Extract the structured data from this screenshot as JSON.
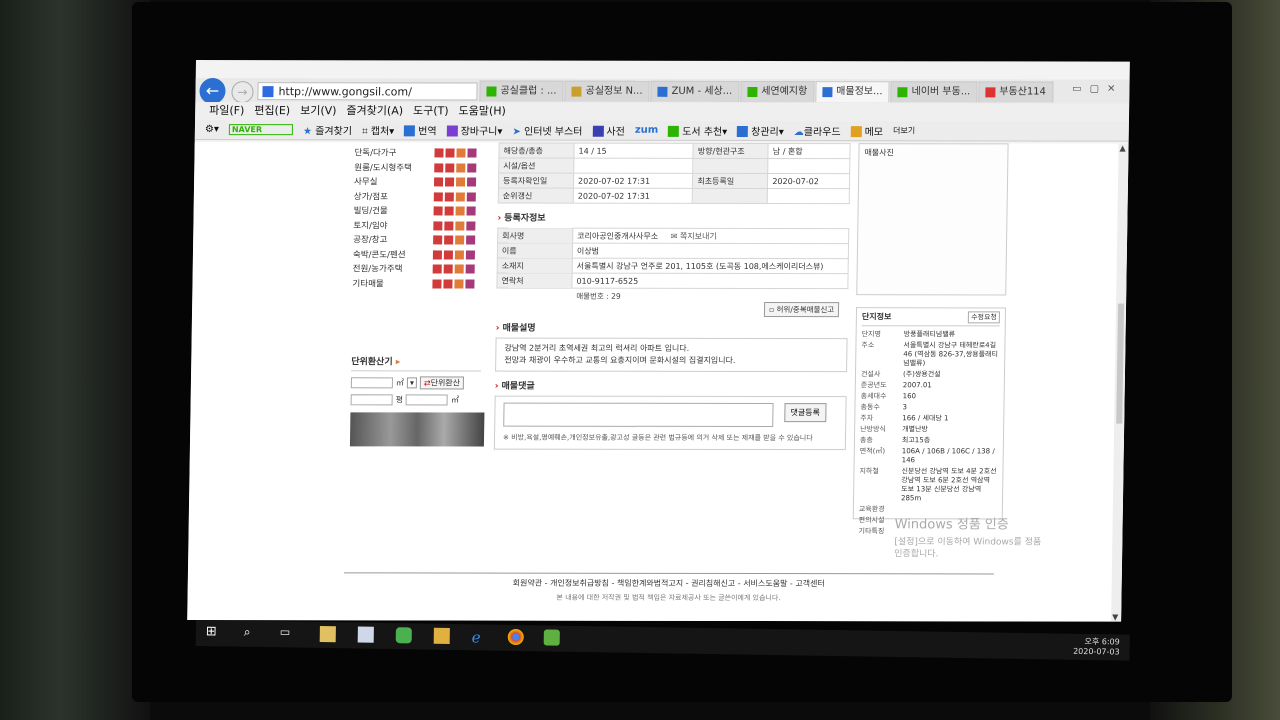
{
  "browser": {
    "address": "http://www.gongsil.com/",
    "tabs": [
      {
        "label": "공실클럽 : ...",
        "color": "#2db400",
        "active": false
      },
      {
        "label": "공실정보 N...",
        "color": "#c9a030",
        "active": false
      },
      {
        "label": "ZUM - 세상...",
        "color": "#2a6fd1",
        "active": false
      },
      {
        "label": "세연예지항",
        "color": "#2db400",
        "active": false
      },
      {
        "label": "매물정보...",
        "color": "#2a6fd1",
        "active": true
      },
      {
        "label": "네이버 부동...",
        "color": "#2db400",
        "active": false
      },
      {
        "label": "부동산114",
        "color": "#d33",
        "active": false
      }
    ],
    "menu": [
      "파일(F)",
      "편집(E)",
      "보기(V)",
      "즐겨찾기(A)",
      "도구(T)",
      "도움말(H)"
    ],
    "toolbar": {
      "naver": "NAVER",
      "favorites": "즐겨찾기",
      "capture": "캡처",
      "translate": "번역",
      "cart": "장바구니",
      "booster": "인터넷 부스터",
      "dict": "사전",
      "zum": "zum",
      "book": "도서 추천",
      "manage": "창관리",
      "cloud": "클라우드",
      "memo": "메모",
      "more": "더보기"
    }
  },
  "left_menu": {
    "items": [
      "단독/다가구",
      "원룸/도시형주택",
      "사무실",
      "상가/점포",
      "빌딩/건물",
      "토지/임야",
      "공장/창고",
      "숙박/콘도/펜션",
      "전원/농가주택",
      "기타매물"
    ],
    "box_colors": [
      "#d23b3b",
      "#d23b3b",
      "#e07b39",
      "#a5397a"
    ]
  },
  "converter": {
    "title": "단위환산기",
    "unit_m2": "㎡",
    "btn": "단위환산",
    "unit_pyeong": "평",
    "unit_m2b": "㎡"
  },
  "listing": {
    "rows": [
      [
        "해당층/총층",
        "14 / 15",
        "방향/현관구조",
        "남 / 혼합"
      ],
      [
        "시설/옵션",
        "",
        "",
        ""
      ],
      [
        "등록자확인일",
        "2020-07-02 17:31",
        "최초등록일",
        "2020-07-02"
      ],
      [
        "순위갱신",
        "2020-07-02 17:31",
        "",
        ""
      ]
    ],
    "agent_title": "등록자정보",
    "agent_rows": [
      [
        "회사명",
        "코리아공인중개사사무소",
        "쪽지보내기"
      ],
      [
        "이름",
        "이상범",
        ""
      ],
      [
        "소재지",
        "서울특별시 강남구 언주로 201, 1105호 (도곡동 108,에스케이리더스뷰)",
        ""
      ],
      [
        "연락처",
        "010-9117-6525",
        ""
      ]
    ],
    "memo_no": "매물번호 : 29",
    "report_btn": "허위/중복매물신고",
    "desc_title": "매물설명",
    "desc_lines": [
      "강남역 2분거리 초역세권 최고의 럭셔리 아파트 입니다.",
      "전망과 채광이 우수하고 교통의 요충지이며 문화시설의 집결지입니다."
    ],
    "comment_title": "매물댓글",
    "comment_btn": "댓글등록",
    "comment_note": "※ 비방,욕설,명예훼손,개인정보유출,광고성 글등은 관련 법규등에 의거 삭제 또는 제재를 받을 수 있습니다"
  },
  "right": {
    "photo_title": "매물사진",
    "complex_title": "단지정보",
    "complex_btn": "수정요청",
    "rows": [
      [
        "단지명",
        "방풍플래티넘밸류"
      ],
      [
        "주소",
        "서울특별시 강남구 테헤란로4길 46 (역삼동 826-37,쌍용플래티넘밸류)"
      ],
      [
        "건설사",
        "(주)쌍용건설"
      ],
      [
        "준공년도",
        "2007.01"
      ],
      [
        "총세대수",
        "160"
      ],
      [
        "총동수",
        "3"
      ],
      [
        "주차",
        "166 / 세대당 1"
      ],
      [
        "난방방식",
        "개별난방"
      ],
      [
        "총층",
        "최고15층"
      ],
      [
        "면적(㎡)",
        "106A / 106B / 106C / 138 / 146"
      ],
      [
        "지하철",
        "신분당선 강남역 도보 4분 2호선 강남역 도보 6분 2호선 역삼역 도보 13분 신분당선 강남역 285m"
      ],
      [
        "교육환경",
        ""
      ],
      [
        "편의시설",
        ""
      ],
      [
        "기타특징",
        ""
      ]
    ]
  },
  "footer": {
    "links": "회원약관 - 개인정보취급방침 - 책임한계와법적고지 - 권리침해신고 - 서비스도움말 - 고객센터",
    "copy": "본 내용에 대한 저작권 및 법적 책임은 자료제공사 또는 글쓴이에게 있습니다."
  },
  "watermark": {
    "line1": "Windows 정품 인증",
    "line2": "[설정]으로 이동하여 Windows를 정품",
    "line3": "인증합니다."
  },
  "tray": {
    "time": "오후 6:09",
    "date": "2020-07-03"
  }
}
